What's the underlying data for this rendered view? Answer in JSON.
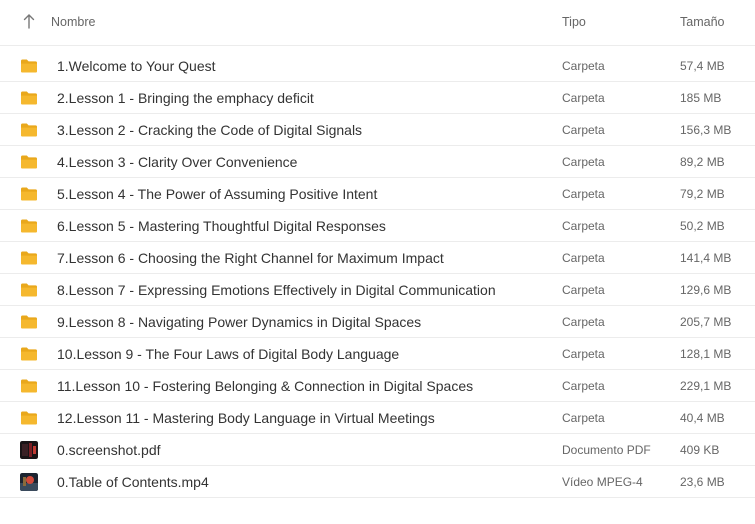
{
  "header": {
    "name_label": "Nombre",
    "type_label": "Tipo",
    "size_label": "Tamaño",
    "sort_icon": "arrow-up-icon"
  },
  "colors": {
    "folder": "#F5B82E",
    "folder_tab": "#E9A81C",
    "divider": "#ECECEC",
    "text_primary": "#333333",
    "text_secondary": "#666666"
  },
  "files": [
    {
      "name": "1.Welcome to Your Quest",
      "type": "Carpeta",
      "size": "57,4 MB",
      "icon": "folder-icon"
    },
    {
      "name": "2.Lesson 1 - Bringing the emphacy deficit",
      "type": "Carpeta",
      "size": "185 MB",
      "icon": "folder-icon"
    },
    {
      "name": "3.Lesson 2 - Cracking the Code of Digital Signals",
      "type": "Carpeta",
      "size": "156,3 MB",
      "icon": "folder-icon"
    },
    {
      "name": "4.Lesson 3 - Clarity Over Convenience",
      "type": "Carpeta",
      "size": "89,2 MB",
      "icon": "folder-icon"
    },
    {
      "name": "5.Lesson 4 - The Power of Assuming Positive Intent",
      "type": "Carpeta",
      "size": "79,2 MB",
      "icon": "folder-icon"
    },
    {
      "name": "6.Lesson 5 - Mastering Thoughtful Digital Responses",
      "type": "Carpeta",
      "size": "50,2 MB",
      "icon": "folder-icon"
    },
    {
      "name": "7.Lesson 6 - Choosing the Right Channel for Maximum Impact",
      "type": "Carpeta",
      "size": "141,4 MB",
      "icon": "folder-icon"
    },
    {
      "name": "8.Lesson 7 - Expressing Emotions Effectively in Digital Communication",
      "type": "Carpeta",
      "size": "129,6 MB",
      "icon": "folder-icon"
    },
    {
      "name": "9.Lesson 8 - Navigating Power Dynamics in Digital Spaces",
      "type": "Carpeta",
      "size": "205,7 MB",
      "icon": "folder-icon"
    },
    {
      "name": "10.Lesson 9 - The Four Laws of Digital Body Language",
      "type": "Carpeta",
      "size": "128,1 MB",
      "icon": "folder-icon"
    },
    {
      "name": "11.Lesson 10 - Fostering Belonging & Connection in Digital Spaces",
      "type": "Carpeta",
      "size": "229,1 MB",
      "icon": "folder-icon"
    },
    {
      "name": "12.Lesson 11 - Mastering Body Language in Virtual Meetings",
      "type": "Carpeta",
      "size": "40,4 MB",
      "icon": "folder-icon"
    },
    {
      "name": "0.screenshot.pdf",
      "type": "Documento PDF",
      "size": "409 KB",
      "icon": "pdf-thumbnail-icon"
    },
    {
      "name": "0.Table of Contents.mp4",
      "type": "Vídeo MPEG-4",
      "size": "23,6 MB",
      "icon": "video-thumbnail-icon"
    }
  ]
}
